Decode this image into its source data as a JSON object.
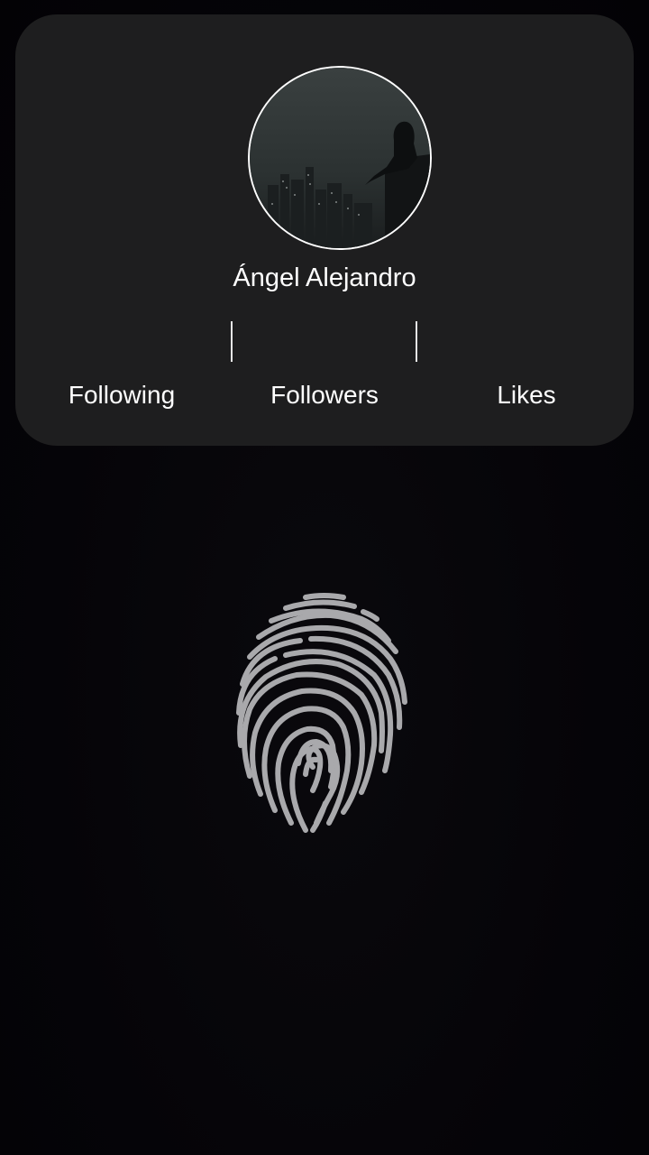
{
  "profile": {
    "display_name": "Ángel Alejandro",
    "stats": {
      "following_label": "Following",
      "followers_label": "Followers",
      "likes_label": "Likes"
    }
  },
  "icons": {
    "avatar": "avatar-photo-hooded-figure-city",
    "fingerprint": "fingerprint-icon"
  },
  "colors": {
    "background": "#050408",
    "card": "#1e1e1f",
    "text": "#ffffff",
    "fingerprint": "#a9a9ac"
  }
}
